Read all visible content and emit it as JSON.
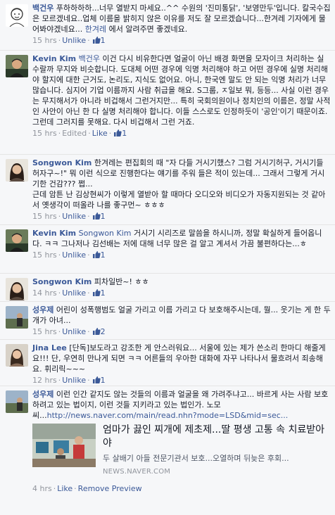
{
  "colors": {
    "link": "#3b5998",
    "meta": "#90949c",
    "text": "#141823",
    "background": "#f6f7f9"
  },
  "comments": [
    {
      "avatar_icon": "profile-sketch-avatar",
      "author": "백건우",
      "text1": "푸하하하하...너무 열받지 마세요..^^ 수원의 '진미통닭', '보영만두'입니다. 칼국수집은 모르겠네요..업체 이름을 밝히지 않은 이유를 저도 잘 모르겠습니다...한겨레 기자에게 물어봐야겠네요... ",
      "mention": "한겨레",
      "text2": " 에서 알려주면 좋겠네요.",
      "time": "15 hrs",
      "action": "Unlike",
      "likes": "1"
    },
    {
      "avatar_icon": "profile-man-avatar",
      "author": "Kevin Kim",
      "mention": "백건우",
      "text1": " 이건 다시 비유한다면 얼굴이 아닌 배경 화면을 모자이크 처리하는 실수랄까 무지와 비슷합니다. 도대체 어떤 경우에 익명 처리해야 하고 어떤 경우에 실명 처리해야 할지에 대한 근거도, 논리도, 지식도 없어요. 아니, 한국엔 말도 안 되는 익명 처리가 너무 많습니다. 심지어 기업 이름까지 사람 취급을 해요. S그룹, ㅈ일보 뭐, 등등... 사실 이런 경우는 무지해서가 아니라 비겁해서 그런거지만... 특히 국회의원이나 정치인의 이름은, 정말 사적인 사안이 아닌 한 다 실명 처리해야 합니다. 이들 스스로도 인정하듯이 '공인'이기 때문이죠. 그런데 그러지를 못해요. 다시 비겁해서 그런 거죠.",
      "time": "15 hrs",
      "edited": "Edited",
      "action": "Like",
      "likes": "1"
    },
    {
      "avatar_icon": "profile-woman-avatar",
      "author": "Songwon Kim",
      "text1": " 한겨레는 편집회의 때 \"자 다들 거시기했스? 그럼 거시기허구, 거시기들 허자구~!\" 뭐 이런 식으로 진행한다는 얘기를 주워 들은 적이 있는데... 그래서 그렇게 거시기한 건감??? 쩝...\n근데 암튼 난 김상현씨가 이렇게 열받아 할 때마다 오디오와 비디오가 자동지원되는 것 같아서 옛생각이 떠올라 나를 좋구먼~ ㅎㅎㅎ",
      "time": "15 hrs",
      "action": "Unlike",
      "likes": "1"
    },
    {
      "avatar_icon": "profile-man-avatar",
      "author": "Kevin Kim",
      "mention": "Songwon Kim",
      "text1": " 거시기 시리즈로 말씀을 하시니까, 정말 확실하게 들어옵니다. ㅋㅋ 그나저나 김선배는 저에 대해 너무 많은 걸 알고 계셔서 가끔 불편하다는...ㅎ",
      "time": "15 hrs",
      "action": "Unlike",
      "likes": "1"
    },
    {
      "avatar_icon": "profile-woman-avatar",
      "author": "Songwon Kim",
      "text1": " 피차일반~! ㅎㅎ",
      "time": "14 hrs",
      "action": "Unlike",
      "likes": "1"
    },
    {
      "avatar_icon": "profile-landscape-avatar",
      "author": "성우제",
      "text1": " 어린이 성폭행범도 얼굴 가리고 이름 가리고 다 보호해주시는데, 뭘... 웃기는 게 한 두 개가 아녀...",
      "time": "15 hrs",
      "action": "Unlike",
      "likes": "2"
    },
    {
      "avatar_icon": "profile-woman-avatar",
      "author": "Jina Lee",
      "text1": " [단독]보도라고 강조한 게 안스러워요... 서울에 있는 제가 쓴소리 한마디 해줄게요!!! 단, 우연히 만나게 되면 ㅋㅋ 어른들의 우아한 대화에 자꾸 나타나서 물흐려서 죄송해요. 휘리릭~~~",
      "time": "12 hrs",
      "action": "Unlike",
      "likes": "1"
    },
    {
      "avatar_icon": "profile-landscape-avatar",
      "author": "성우제",
      "text1": " 이런 인간 같지도 않는 것들의 이름과 얼굴을 왜 가려주냐고... 바르게 사는 사람 보호하려고 있는 법이지, 이런 것들 지키라고 있는 법인가. 노모씨...",
      "link": "http://news.naver.com/main/read.nhn?mode=LSD&mid=sec...",
      "share": {
        "title": "엄마가 끓인 찌개에 제초제...딸 평생 고통 속 치료받아야",
        "desc": "두 살배기 아들 전문기관서 보호...오열하며 뒤늦은 후회...",
        "domain": "NEWS.NAVER.COM"
      },
      "time": "4 hrs",
      "action": "Like",
      "remove": "Remove Preview"
    }
  ]
}
